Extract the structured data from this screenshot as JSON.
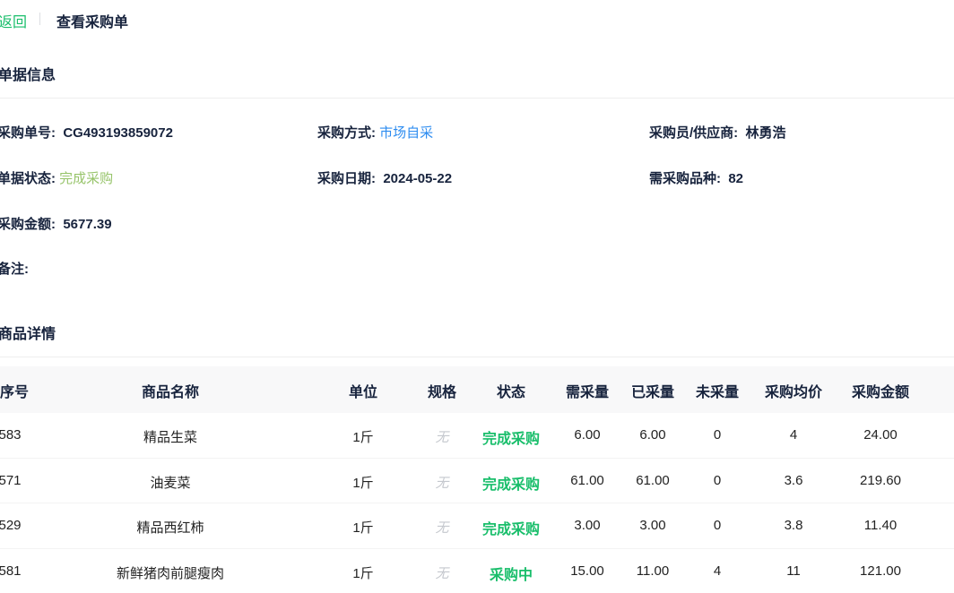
{
  "header": {
    "back_label": "返回",
    "title": "查看采购单"
  },
  "info_section": {
    "title": "单据信息",
    "order_no_label": "采购单号:",
    "order_no": "CG493193859072",
    "method_label": "采购方式:",
    "method": "市场自采",
    "buyer_label": "采购员/供应商:",
    "buyer": "林勇浩",
    "status_label": "单据状态:",
    "status": "完成采购",
    "date_label": "采购日期:",
    "date": "2024-05-22",
    "kinds_label": "需采购品种:",
    "kinds": "82",
    "amount_label": "采购金额:",
    "amount": "5677.39",
    "remark_label": "备注:",
    "remark": ""
  },
  "detail_section": {
    "title": "商品详情",
    "columns": [
      "序号",
      "商品名称",
      "单位",
      "规格",
      "状态",
      "需采量",
      "已采量",
      "未采量",
      "采购均价",
      "采购金额"
    ],
    "rows": [
      {
        "no": "583",
        "name": "精品生菜",
        "unit": "1斤",
        "spec": "无",
        "status": "完成采购",
        "need": "6.00",
        "done": "6.00",
        "left": "0",
        "avg_price": "4",
        "amount": "24.00"
      },
      {
        "no": "571",
        "name": "油麦菜",
        "unit": "1斤",
        "spec": "无",
        "status": "完成采购",
        "need": "61.00",
        "done": "61.00",
        "left": "0",
        "avg_price": "3.6",
        "amount": "219.60"
      },
      {
        "no": "529",
        "name": "精品西红柿",
        "unit": "1斤",
        "spec": "无",
        "status": "完成采购",
        "need": "3.00",
        "done": "3.00",
        "left": "0",
        "avg_price": "3.8",
        "amount": "11.40"
      },
      {
        "no": "581",
        "name": "新鲜猪肉前腿瘦肉",
        "unit": "1斤",
        "spec": "无",
        "status": "采购中",
        "need": "15.00",
        "done": "11.00",
        "left": "4",
        "avg_price": "11",
        "amount": "121.00"
      }
    ]
  },
  "colors": {
    "green": "#19be6b",
    "blue": "#2d8cf0",
    "light_green": "#97c46a",
    "header_bg": "#f8f8f9"
  }
}
